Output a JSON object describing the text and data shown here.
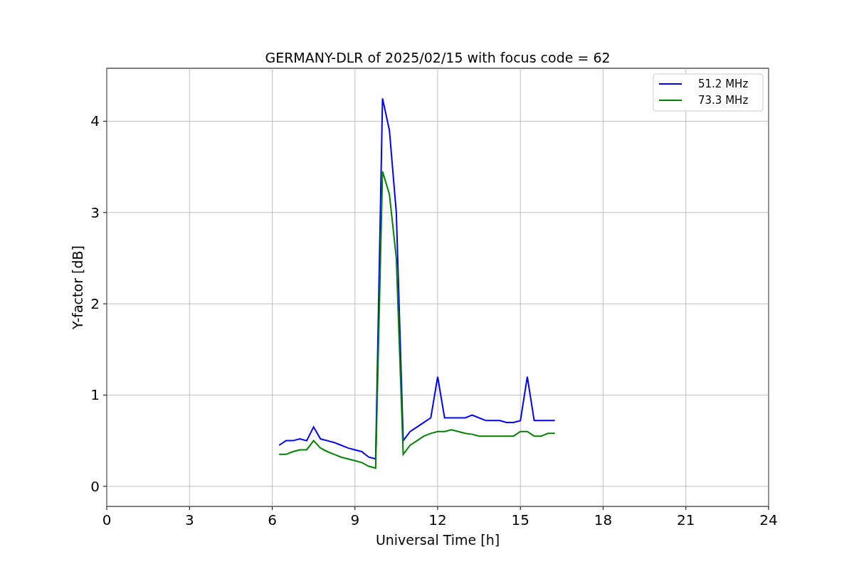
{
  "chart_data": {
    "type": "line",
    "title": "GERMANY-DLR of 2025/02/15 with focus code = 62",
    "xlabel": "Universal Time [h]",
    "ylabel": "Y-factor [dB]",
    "x": [
      6.25,
      6.5,
      6.75,
      7,
      7.25,
      7.5,
      7.75,
      8,
      8.25,
      8.5,
      8.75,
      9,
      9.25,
      9.5,
      9.75,
      10,
      10.25,
      10.5,
      10.75,
      11,
      11.25,
      11.5,
      11.75,
      12,
      12.25,
      12.5,
      12.75,
      13,
      13.25,
      13.5,
      13.75,
      14,
      14.25,
      14.5,
      14.75,
      15,
      15.25,
      15.5,
      15.75,
      16,
      16.25
    ],
    "series": [
      {
        "name": "51.2 MHz",
        "color": "#0000ff",
        "values": [
          0.45,
          0.5,
          0.5,
          0.52,
          0.5,
          0.65,
          0.52,
          0.5,
          0.48,
          0.45,
          0.42,
          0.4,
          0.38,
          0.32,
          0.3,
          4.25,
          3.9,
          3.0,
          0.5,
          0.6,
          0.65,
          0.7,
          0.75,
          1.2,
          0.75,
          0.75,
          0.75,
          0.75,
          0.78,
          0.75,
          0.72,
          0.72,
          0.72,
          0.7,
          0.7,
          0.72,
          1.2,
          0.72,
          0.72,
          0.72,
          0.72
        ]
      },
      {
        "name": "73.3 MHz",
        "color": "#008000",
        "values": [
          0.35,
          0.35,
          0.38,
          0.4,
          0.4,
          0.5,
          0.42,
          0.38,
          0.35,
          0.32,
          0.3,
          0.28,
          0.26,
          0.22,
          0.2,
          3.45,
          3.2,
          2.5,
          0.35,
          0.45,
          0.5,
          0.55,
          0.58,
          0.6,
          0.6,
          0.62,
          0.6,
          0.58,
          0.57,
          0.55,
          0.55,
          0.55,
          0.55,
          0.55,
          0.55,
          0.6,
          0.6,
          0.55,
          0.55,
          0.58,
          0.58
        ]
      }
    ],
    "grid": true,
    "legend": true,
    "xlim": [
      0,
      24
    ],
    "ylim": [
      -0.22,
      4.58
    ],
    "xticks": [
      0,
      3,
      6,
      9,
      12,
      15,
      18,
      21,
      24
    ],
    "yticks": [
      0,
      1,
      2,
      3,
      4
    ]
  }
}
